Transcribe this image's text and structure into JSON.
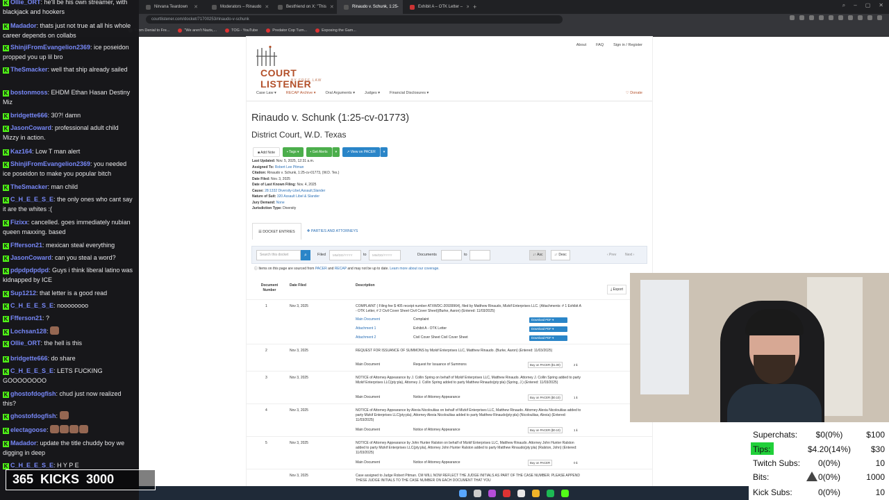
{
  "browser": {
    "tabs": [
      {
        "label": "Nirvana Teardown"
      },
      {
        "label": "Moderators – Rinaudo"
      },
      {
        "label": "Bestfriend on X: \"This"
      },
      {
        "label": "Rinaudo v. Schunk, 1:25-",
        "active": true
      },
      {
        "label": "Exhibit A – OTK Letter –"
      }
    ],
    "address": "courtlistener.com/docket/71700253/rinaudo-v-schunk",
    "bookmarks": [
      "From Denial to Fre...",
      "\"We aren't Nazis,...",
      "TOG - YouTube",
      "Predator Cop Turn...",
      "Exposing the Gam..."
    ]
  },
  "site": {
    "topnav": [
      "About",
      "FAQ",
      "Sign in / Register"
    ],
    "logo_name": "COURT LISTENER",
    "logo_by": "BY FREE.LAW",
    "mainnav": [
      "Case Law ▾",
      "RECAP Archive ▾",
      "Oral Arguments ▾",
      "Judges ▾",
      "Financial Disclosures ▾"
    ],
    "donate": "♡ Donate",
    "case_title": "Rinaudo v. Schunk (1:25-cv-01773)",
    "court": "District Court, W.D. Texas",
    "buttons": {
      "add_note": "■ Add Note",
      "tags": "▪ Tags ▾",
      "alerts": "▪ Get Alerts",
      "view_pacer": "↗ View on PACER"
    },
    "meta": [
      {
        "k": "Last Updated:",
        "v": "Nov. 5, 2025, 12:31 a.m.",
        "link": false
      },
      {
        "k": "Assigned To:",
        "v": "Robert Lee Pitman",
        "link": true
      },
      {
        "k": "Citation:",
        "v": "Rinaudo v. Schunk, 1:25-cv-01773, (W.D. Tex.)",
        "link": false
      },
      {
        "k": "Date Filed:",
        "v": "Nov. 3, 2025",
        "link": false
      },
      {
        "k": "Date of Last Known Filing:",
        "v": "Nov. 4, 2025",
        "link": false
      },
      {
        "k": "Cause:",
        "v": "28:1332 Diversity-Libel,Assault,Slander",
        "link": true
      },
      {
        "k": "Nature of Suit:",
        "v": "320 Assault Libel & Slander",
        "link": true
      },
      {
        "k": "Jury Demand:",
        "v": "None",
        "link": true
      },
      {
        "k": "Jurisdiction Type:",
        "v": "Diversity",
        "link": false
      }
    ],
    "tab_docket": "☰ DOCKET ENTRIES",
    "tab_parties": "❖ PARTIES AND ATTORNEYS",
    "filter": {
      "search_placeholder": "Search this docket",
      "filed": "Filed",
      "to": "to",
      "date_placeholder": "MM/DD/YYYY",
      "documents": "Documents",
      "asc": "↓↑ Asc",
      "desc": "↓↑ Desc",
      "prev": "‹ Prev",
      "next": "Next ›"
    },
    "notice_text": "ⓘ Items on this page are sourced from",
    "notice_pacer": "PACER",
    "notice_and": "and",
    "notice_recap": "RECAP",
    "notice_rest": "and may not be up to date.",
    "notice_link": "Learn more about our coverage.",
    "headers": {
      "num": "Document Number",
      "date": "Date Filed",
      "desc": "Description",
      "export": "⤓ Export"
    },
    "entries": [
      {
        "num": "1",
        "date": "Nov 3, 2025",
        "desc": "COMPLAINT ( Filing fee $ 405 receipt number ATXWDC-20939964), filed by Matthew Rinaudo, Mizkif Enterprises LLC. (Attachments: # 1 Exhibit A - OTK Letter, # 2 Civil Cover Sheet Civil Cover Sheet)(Burke, Aaron) (Entered: 11/03/2025)"
      },
      {
        "num": "2",
        "date": "Nov 3, 2025",
        "desc": "REQUEST FOR ISSUANCE OF SUMMONS by Mizkif Enterprises LLC, Matthew Rinaudo. (Burke, Aaron) (Entered: 11/03/2025)"
      },
      {
        "num": "3",
        "date": "Nov 3, 2025",
        "desc": "NOTICE of Attorney Appearance by J. Collin Spring on behalf of Mizkif Enterprises LLC, Matthew Rinaudo. Attorney J. Collin Spring added to party Mizkif Enterprises LLC(pty:pla), Attorney J. Collin Spring added to party Matthew Rinaudo(pty:pla) (Spring, J.) (Entered: 11/03/2025)"
      },
      {
        "num": "4",
        "date": "Nov 3, 2025",
        "desc": "NOTICE of Attorney Appearance by Alexia Nicolouliias on behalf of Mizkif Enterprises LLC, Matthew Rinaudo. Attorney Alexia Nicolouliias added to party Mizkif Enterprises LLC(pty:pla), Attorney Alexia Nicolouliias added to party Matthew Rinaudo(pty:pla) (Nicolouliias, Alexia) (Entered: 11/03/2025)"
      },
      {
        "num": "5",
        "date": "Nov 3, 2025",
        "desc": "NOTICE of Attorney Appearance by John Hunter Ralston on behalf of Mizkif Enterprises LLC, Matthew Rinaudo. Attorney John Hunter Ralston added to party Mizkif Enterprises LLC(pty:pla), Attorney John Hunter Ralston added to party Matthew Rinaudo(pty:pla) (Ralston, John) (Entered: 11/03/2025)"
      },
      {
        "num": "",
        "date": "Nov 3, 2025",
        "desc": "Case assigned to Judge Robert Pitman. CM WILL NOW REFLECT THE JUDGE INITIALS AS PART OF THE CASE NUMBER. PLEASE APPEND THESE JUDGE INITIALS TO THE CASE NUMBER ON EACH DOCUMENT THAT YOU"
      }
    ],
    "docs": {
      "main": "Main Document",
      "att1": "Attachment 1",
      "att2": "Attachment 2",
      "complaint": "Complaint",
      "exhibit": "Exhibit A - OTK Letter",
      "civil": "Civil Cover Sheet Civil Cover Sheet",
      "download": "Download PDF ▾",
      "summons": "Request for Issuance of Summons",
      "notice": "Notice of Attorney Appearance",
      "buy1": "Buy on PACER ($1.00)",
      "buy010": "Buy on PACER ($0.10)",
      "buy": "Buy on PACER",
      "cnt2": "2 ℹ",
      "cnt1": "1 ℹ",
      "cnt0": "0 ℹ"
    }
  },
  "chat": [
    {
      "user": "Ollie_ORT",
      "color": "#7b8cff",
      "text": "he'll be his own streamer, with blackjack and hookers"
    },
    {
      "user": "Madador",
      "color": "#7b8cff",
      "text": "thats just not true at all his whole career depends on collabs"
    },
    {
      "user": "ShinjiFromEvangelion2369",
      "color": "#7b8cff",
      "text": "ice poseidon propped you up lil bro"
    },
    {
      "user": "TheSmacker",
      "color": "#7b8cff",
      "text": "well that ship already sailed"
    },
    {
      "user": "bostonmoss",
      "color": "#7b8cff",
      "text": "EHDM Ethan Hasan Destiny Miz"
    },
    {
      "user": "bridgette666",
      "color": "#7b8cff",
      "text": "30?! damn"
    },
    {
      "user": "JasonCoward",
      "color": "#7b8cff",
      "text": "professional adult child Mizzy in action."
    },
    {
      "user": "Kaz164",
      "color": "#7b8cff",
      "text": "Low T man alert"
    },
    {
      "user": "ShinjiFromEvangelion2369",
      "color": "#7b8cff",
      "text": "you needed ice poseidon to make you popular bitch"
    },
    {
      "user": "TheSmacker",
      "color": "#7b8cff",
      "text": "man child"
    },
    {
      "user": "C_H_E_E_S_E",
      "color": "#7b8cff",
      "text": "the only ones who cant say it are the whites :("
    },
    {
      "user": "Fizixx",
      "color": "#7b8cff",
      "text": "cancelled. goes immediately nubian queen maxxing. based"
    },
    {
      "user": "Ffferson21",
      "color": "#7b8cff",
      "text": "mexican steal everything"
    },
    {
      "user": "JasonCoward",
      "color": "#7b8cff",
      "text": "can you steal a word?"
    },
    {
      "user": "pdpdpdpdpd",
      "color": "#7b8cff",
      "text": "Guys i think liberal latino was kidnapped by ICE"
    },
    {
      "user": "Sup1212",
      "color": "#7b8cff",
      "text": "that letter is a good read"
    },
    {
      "user": "C_H_E_E_S_E",
      "color": "#7b8cff",
      "text": "noooooooo"
    },
    {
      "user": "Ffferson21",
      "color": "#7b8cff",
      "text": "?"
    },
    {
      "user": "Lochsan128",
      "color": "#7b8cff",
      "text": ""
    },
    {
      "user": "Ollie_ORT",
      "color": "#7b8cff",
      "text": "the hell is this"
    },
    {
      "user": "bridgette666",
      "color": "#7b8cff",
      "text": "do share"
    },
    {
      "user": "C_H_E_E_S_E",
      "color": "#7b8cff",
      "text": "LETS FUCKING GOOOOOOOO"
    },
    {
      "user": "ghostofdogfish",
      "color": "#7b8cff",
      "text": "chud just now realized this?"
    },
    {
      "user": "ghostofdogfish",
      "color": "#7b8cff",
      "text": ""
    },
    {
      "user": "electagoose",
      "color": "#7b8cff",
      "text": ""
    },
    {
      "user": "Madador",
      "color": "#7b8cff",
      "text": "update the title chuddy boy we digging in deep"
    },
    {
      "user": "C_H_E_E_S_E",
      "color": "#7b8cff",
      "text": "H Y P E"
    }
  ],
  "kick_banner": "365  KICKS  3000",
  "stats": [
    {
      "label": "Superchats:",
      "value": "$0(0%)",
      "goal": "$100"
    },
    {
      "label": "Tips:",
      "value": "$4.20(14%)",
      "goal": "$30"
    },
    {
      "label": "Twitch Subs:",
      "value": "0(0%)",
      "goal": "10"
    },
    {
      "label": "Bits:",
      "value": "0(0%)",
      "goal": "1000"
    },
    {
      "label": "Kick Subs:",
      "value": "0(0%)",
      "goal": "10"
    }
  ],
  "colors": {
    "accent": "#b3502a",
    "link": "#2a6fb5",
    "button_blue": "#2a85c8",
    "button_green": "#4cae4c",
    "kick_green": "#53fc18",
    "tips_green": "#21d03a"
  }
}
